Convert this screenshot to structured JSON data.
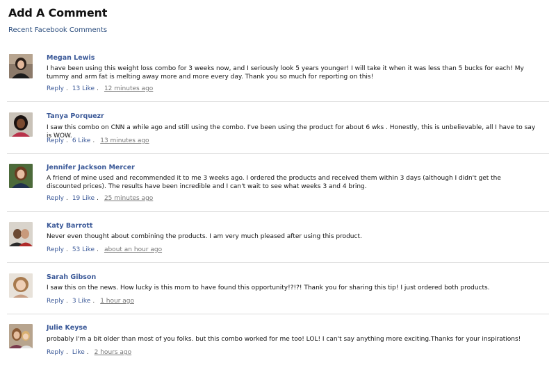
{
  "header": {
    "title": "Add A Comment",
    "subtitle": "Recent Facebook Comments"
  },
  "comments": [
    {
      "name": "Megan Lewis",
      "text": "I have been using this weight loss combo for 3 weeks now, and I seriously look 5 years younger! I will take it when it was less than 5 bucks for each! My tummy and arm fat is melting away more and more every day. Thank you so much for reporting on this!",
      "reply": "Reply",
      "likes": "13 Like",
      "time": "12 minutes ago"
    },
    {
      "name": "Tanya Porquezr",
      "text": "I saw this combo on CNN a while ago and still using the combo. I've been using the product for about 6 wks . Honestly, this is unbelievable, all I have to say is WOW.",
      "reply": "Reply",
      "likes": "6 Like",
      "time": "13 minutes ago"
    },
    {
      "name": "Jennifer Jackson Mercer",
      "text": "A friend of mine used and recommended it to me 3 weeks ago. I ordered the products and received them within 3 days (although I didn't get the discounted prices). The results have been incredible and I can't wait to see what weeks 3 and 4 bring.",
      "reply": "Reply",
      "likes": "19 Like",
      "time": "25 minutes ago"
    },
    {
      "name": "Katy Barrott",
      "text": "Never even thought about combining the products. I am very much pleased after using this product.",
      "reply": "Reply",
      "likes": "53 Like",
      "time": "about an hour ago"
    },
    {
      "name": "Sarah Gibson",
      "text": "I saw this on the news. How lucky is this mom to have found this opportunity!?!?! Thank you for sharing this tip! I just ordered both products.",
      "reply": "Reply",
      "likes": "3 Like",
      "time": "1 hour ago"
    },
    {
      "name": "Julie Keyse",
      "text": "probably I'm a bit older than most of you folks. but this combo worked for me too! LOL! I can't say anything more exciting.Thanks for your inspirations!",
      "reply": "Reply",
      "likes": "Like",
      "time": "2 hours ago"
    }
  ]
}
